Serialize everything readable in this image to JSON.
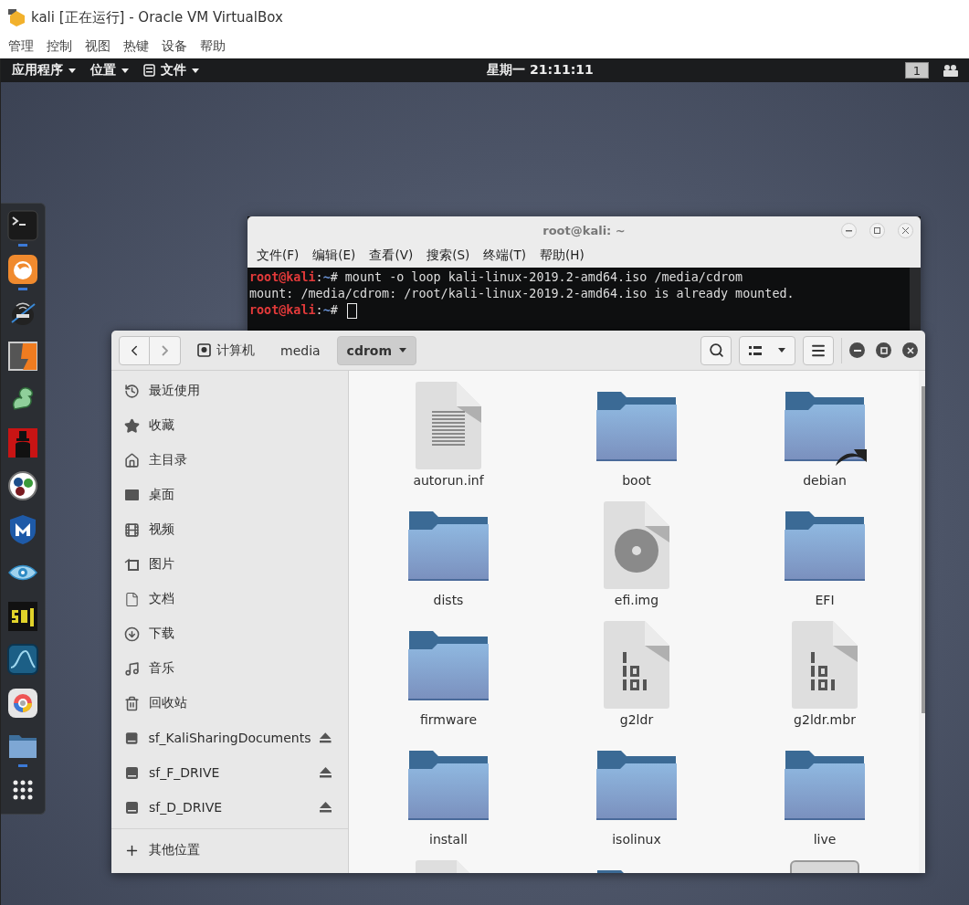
{
  "host_window": {
    "title": "kali [正在运行] - Oracle VM VirtualBox",
    "menu": [
      "管理",
      "控制",
      "视图",
      "热键",
      "设备",
      "帮助"
    ]
  },
  "top_bar": {
    "menus": [
      {
        "label": "应用程序",
        "kind": "plain"
      },
      {
        "label": "位置",
        "kind": "plain"
      },
      {
        "label": "文件",
        "kind": "app"
      }
    ],
    "clock": "星期一 21:11:11",
    "workspace": "1"
  },
  "dock": {
    "items": [
      {
        "kind": "terminal",
        "running": true
      },
      {
        "kind": "fox",
        "running": true
      },
      {
        "kind": "antenna",
        "running": false
      },
      {
        "kind": "bolt",
        "running": false
      },
      {
        "kind": "serpent",
        "running": false
      },
      {
        "kind": "hat",
        "running": false
      },
      {
        "kind": "dots",
        "running": false
      },
      {
        "kind": "shield",
        "running": false
      },
      {
        "kind": "eye",
        "running": false
      },
      {
        "kind": "pixel",
        "running": false
      },
      {
        "kind": "fin",
        "running": false
      },
      {
        "kind": "ring",
        "running": false
      },
      {
        "kind": "folder",
        "running": true
      },
      {
        "kind": "grid",
        "running": false
      }
    ]
  },
  "terminal": {
    "title": "root@kali: ~",
    "menu": [
      "文件(F)",
      "编辑(E)",
      "查看(V)",
      "搜索(S)",
      "终端(T)",
      "帮助(H)"
    ],
    "lines": [
      {
        "kind": "prompt",
        "user": "root@kali",
        "sep": ":",
        "path": "~",
        "mark": "#",
        "command": "mount -o loop kali-linux-2019.2-amd64.iso /media/cdrom"
      },
      {
        "kind": "output",
        "text": "mount: /media/cdrom: /root/kali-linux-2019.2-amd64.iso is already mounted."
      },
      {
        "kind": "prompt",
        "user": "root@kali",
        "sep": ":",
        "path": "~",
        "mark": "#",
        "cursor": true
      }
    ]
  },
  "files": {
    "path": [
      {
        "label": "计算机",
        "kind": "drive",
        "selected": false
      },
      {
        "label": "media",
        "kind": "plain",
        "selected": false
      },
      {
        "label": "cdrom",
        "kind": "menu",
        "selected": true
      }
    ],
    "sidebar": [
      {
        "label": "最近使用",
        "kind": "recent",
        "eject": false
      },
      {
        "label": "收藏",
        "kind": "star",
        "eject": false
      },
      {
        "label": "主目录",
        "kind": "home",
        "eject": false
      },
      {
        "label": "桌面",
        "kind": "desktop",
        "eject": false
      },
      {
        "label": "视频",
        "kind": "video",
        "eject": false
      },
      {
        "label": "图片",
        "kind": "picture",
        "eject": false
      },
      {
        "label": "文档",
        "kind": "document",
        "eject": false
      },
      {
        "label": "下载",
        "kind": "download",
        "eject": false
      },
      {
        "label": "音乐",
        "kind": "music",
        "eject": false
      },
      {
        "label": "回收站",
        "kind": "trash",
        "eject": false
      },
      {
        "label": "sf_KaliSharingDocuments",
        "kind": "drive",
        "eject": true
      },
      {
        "label": "sf_F_DRIVE",
        "kind": "drive",
        "eject": true
      },
      {
        "label": "sf_D_DRIVE",
        "kind": "drive",
        "eject": true
      }
    ],
    "other_places": "其他位置",
    "items": [
      {
        "name": "autorun.inf",
        "kind": "text",
        "link": false
      },
      {
        "name": "boot",
        "kind": "folder",
        "link": false
      },
      {
        "name": "debian",
        "kind": "folder",
        "link": true
      },
      {
        "name": "dists",
        "kind": "folder",
        "link": false
      },
      {
        "name": "efi.img",
        "kind": "disc",
        "link": false
      },
      {
        "name": "EFI",
        "kind": "folder",
        "link": false
      },
      {
        "name": "firmware",
        "kind": "folder",
        "link": false
      },
      {
        "name": "g2ldr",
        "kind": "binary",
        "link": false
      },
      {
        "name": "g2ldr.mbr",
        "kind": "binary",
        "link": false
      },
      {
        "name": "install",
        "kind": "folder",
        "link": false
      },
      {
        "name": "isolinux",
        "kind": "folder",
        "link": false
      },
      {
        "name": "live",
        "kind": "folder",
        "link": false
      },
      {
        "kind": "text",
        "link": false
      },
      {
        "kind": "folder",
        "link": false
      },
      {
        "kind": "package",
        "link": false
      }
    ]
  }
}
